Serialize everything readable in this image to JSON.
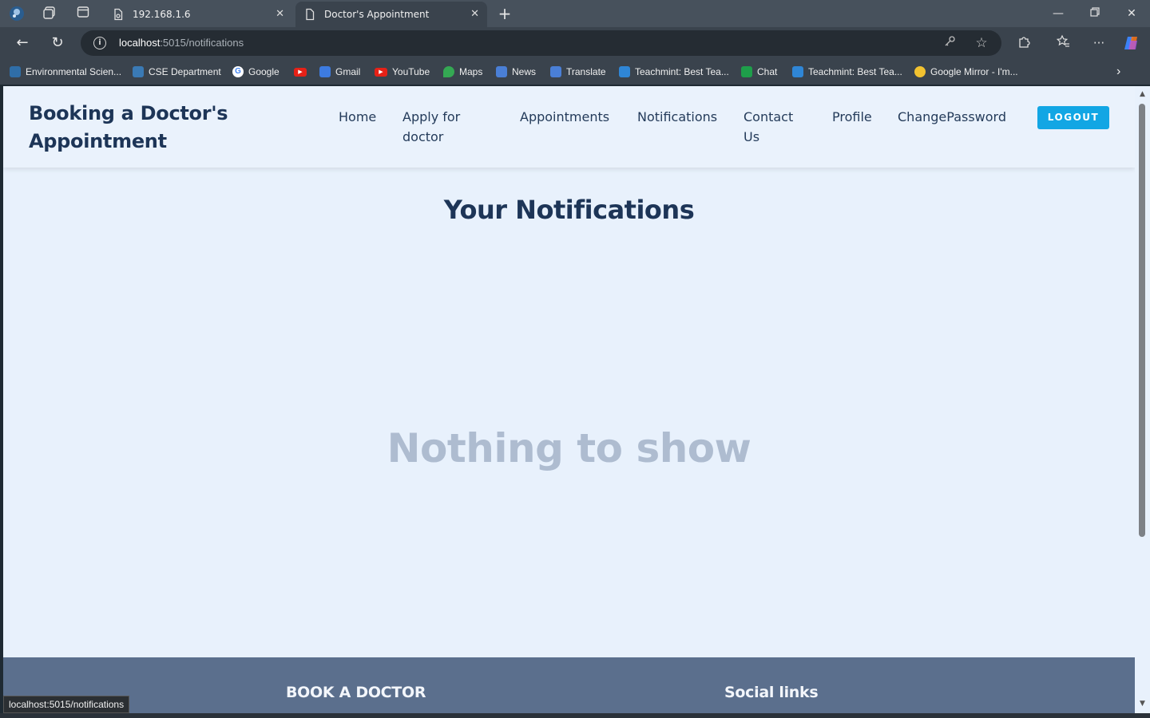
{
  "browser": {
    "tabs": [
      {
        "title": "192.168.1.6",
        "close": "✕"
      },
      {
        "title": "Doctor's Appointment",
        "close": "✕"
      }
    ],
    "new_tab": "+",
    "address": {
      "host": "localhost",
      "path": ":5015/notifications"
    },
    "bookmarks": [
      {
        "label": "Environmental Scien...",
        "color": "#2f6ea8"
      },
      {
        "label": "CSE Department",
        "color": "#3a7ab5"
      },
      {
        "label": "Google",
        "color": "#ffffff"
      },
      {
        "label": "",
        "color": "#e62117"
      },
      {
        "label": "Gmail",
        "color": "#3d7be0"
      },
      {
        "label": "YouTube",
        "color": "#e62117"
      },
      {
        "label": "Maps",
        "color": "#34a853"
      },
      {
        "label": "News",
        "color": "#4a7fd6"
      },
      {
        "label": "Translate",
        "color": "#4a7fd6"
      },
      {
        "label": "Teachmint: Best Tea...",
        "color": "#2f86d6"
      },
      {
        "label": "Chat",
        "color": "#1e9e4a"
      },
      {
        "label": "Teachmint: Best Tea...",
        "color": "#2f86d6"
      },
      {
        "label": "Google Mirror - I'm...",
        "color": "#f2c230"
      }
    ],
    "status_url": "localhost:5015/notifications"
  },
  "header": {
    "brand": "Booking a Doctor's Appointment",
    "nav": [
      "Home",
      "Apply for doctor",
      "Appointments",
      "Notifications",
      "Contact Us",
      "Profile",
      "ChangePassword"
    ],
    "logout": "LOGOUT"
  },
  "main": {
    "title": "Your Notifications",
    "empty_message": "Nothing to show"
  },
  "footer": {
    "book_heading": "BOOK A DOCTOR",
    "social_heading": "Social links"
  },
  "colors": {
    "primary_text": "#1d3557",
    "accent": "#12a6e4",
    "muted": "#aebcd0",
    "footer_bg": "#5b6f8d",
    "page_bg": "#e8f1fc"
  }
}
